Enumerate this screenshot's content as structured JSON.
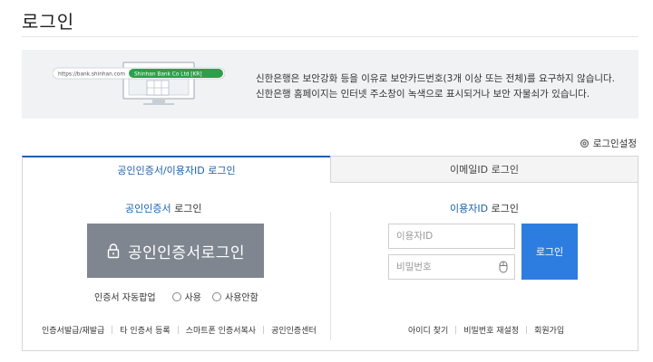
{
  "page": {
    "title": "로그인"
  },
  "notice": {
    "illust_url": "https://bank.shinhan.com",
    "illust_company": "Shinhan Bank Co Ltd [KR]",
    "line1": "신한은행은 보안강화 등을 이유로 보안카드번호(3개 이상 또는 전체)를 요구하지 않습니다.",
    "line2": "신한은행 홈페이지는 인터넷 주소창이 녹색으로 표시되거나 보안 자물쇠가 있습니다."
  },
  "settings": {
    "label": "로그인설정"
  },
  "tabs": [
    {
      "label": "공인인증서/이용자ID 로그인",
      "active": true
    },
    {
      "label": "이메일ID 로그인",
      "active": false
    }
  ],
  "cert": {
    "title_hl": "공인인증서",
    "title_rest": " 로그인",
    "button": "공인인증서로그인",
    "autopop_label": "인증서 자동팝업",
    "opt_use": "사용",
    "opt_nouse": "사용안함",
    "links": [
      "인증서발급/재발급",
      "타 인증서 등록",
      "스마트폰 인증서복사",
      "공인인증센터"
    ]
  },
  "idlogin": {
    "title_hl": "이용자ID",
    "title_rest": " 로그인",
    "id_placeholder": "이용자ID",
    "pw_placeholder": "비밀번호",
    "button": "로그인",
    "links": [
      "아이디 찾기",
      "비밀번호 재설정",
      "회원가입"
    ]
  },
  "colors": {
    "primary": "#1b5faa",
    "login_button": "#2d7de0",
    "cert_button": "#7f8690",
    "notice_bg": "#f1f2f4"
  }
}
